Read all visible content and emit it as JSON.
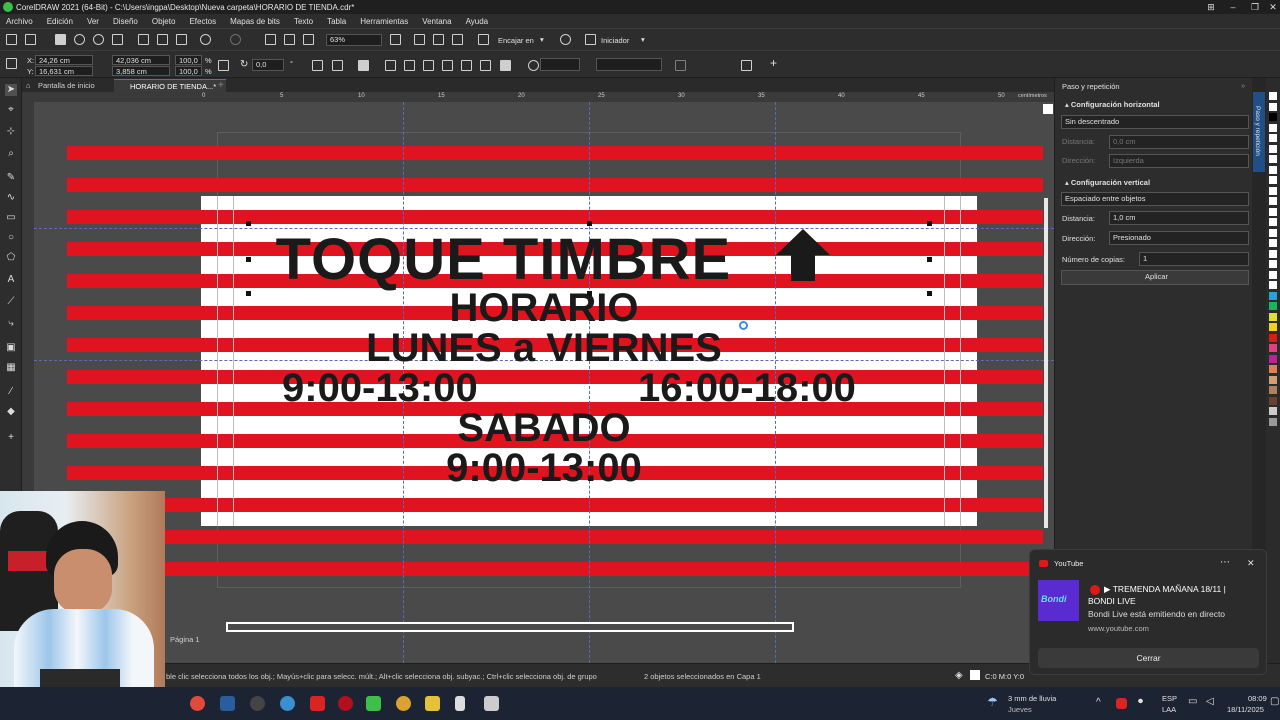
{
  "window": {
    "title": "CorelDRAW 2021 (64-Bit) - C:\\Users\\ingpa\\Desktop\\Nueva carpeta\\HORARIO DE TIENDA.cdr*",
    "minimize": "–",
    "restore": "❐",
    "close": "✕"
  },
  "menu": [
    "Archivo",
    "Edición",
    "Ver",
    "Diseño",
    "Objeto",
    "Efectos",
    "Mapas de bits",
    "Texto",
    "Tabla",
    "Herramientas",
    "Ventana",
    "Ayuda"
  ],
  "toolbar": {
    "zoom": "63%",
    "snap_label": "Encajar en",
    "launcher_label": "Iniciador"
  },
  "property_bar": {
    "x": "24,26 cm",
    "y": "16,631 cm",
    "w": "42,036 cm",
    "h": "3,858 cm",
    "sx": "100,0",
    "sy": "100,0",
    "pct": "%",
    "angle": "0,0"
  },
  "doc_tabs": [
    "Pantalla de inicio",
    "HORARIO DE TIENDA...*"
  ],
  "ruler": {
    "unit": "centímetros",
    "ticks": [
      "0",
      "5",
      "10",
      "15",
      "20",
      "25",
      "30",
      "35",
      "40",
      "45",
      "50"
    ]
  },
  "sign": {
    "line1": "TOQUE TIMBRE",
    "line2": "HORARIO",
    "line3": "LUNES a VIERNES",
    "line4a": "9:00-13:00",
    "line4b": "16:00-18:00",
    "line5": "SABADO",
    "line6": "9:00-13:00"
  },
  "page_label": "Página 1",
  "status": {
    "hint": "ble clic selecciona todos los obj.; Mayús+clic para selecc. múlt.; Alt+clic selecciona obj. subyac.; Ctrl+clic selecciona obj. de grupo",
    "selection": "2 objetos seleccionados en Capa 1",
    "color": "C:0 M:0 Y:0"
  },
  "docker": {
    "title": "Paso y repetición",
    "tab_label": "Paso y repetición",
    "h_section": "Configuración horizontal",
    "h_mode": "Sin descentrado",
    "h_distance_label": "Distancia:",
    "h_distance": "0,0 cm",
    "h_direction_label": "Dirección:",
    "h_direction": "Izquierda",
    "v_section": "Configuración vertical",
    "v_mode": "Espaciado entre objetos",
    "v_distance_label": "Distancia:",
    "v_distance": "1,0 cm",
    "v_direction_label": "Dirección:",
    "v_direction": "Presionado",
    "copies_label": "Número de copias:",
    "copies": "1",
    "apply": "Aplicar"
  },
  "notification": {
    "app": "YouTube",
    "title": "▶ TREMENDA MAÑANA 18/11 | BONDI LIVE",
    "line1": "▶ TREMENDA MAÑANA 18/11 |",
    "line2": "BONDI LIVE",
    "body": "Bondi Live está emitiendo en directo",
    "url": "www.youtube.com",
    "close_btn": "Cerrar",
    "thumb_text": "Bondi"
  },
  "taskbar": {
    "weather": "3 mm de lluvia",
    "day": "Jueves",
    "lang1": "ESP",
    "lang2": "LAA",
    "time": "08:09",
    "date": "18/11/2025"
  },
  "colors": {
    "stripe_red": "#e0141f",
    "canvas_bg": "#4a4a4a",
    "accent": "#2f7bd6"
  }
}
